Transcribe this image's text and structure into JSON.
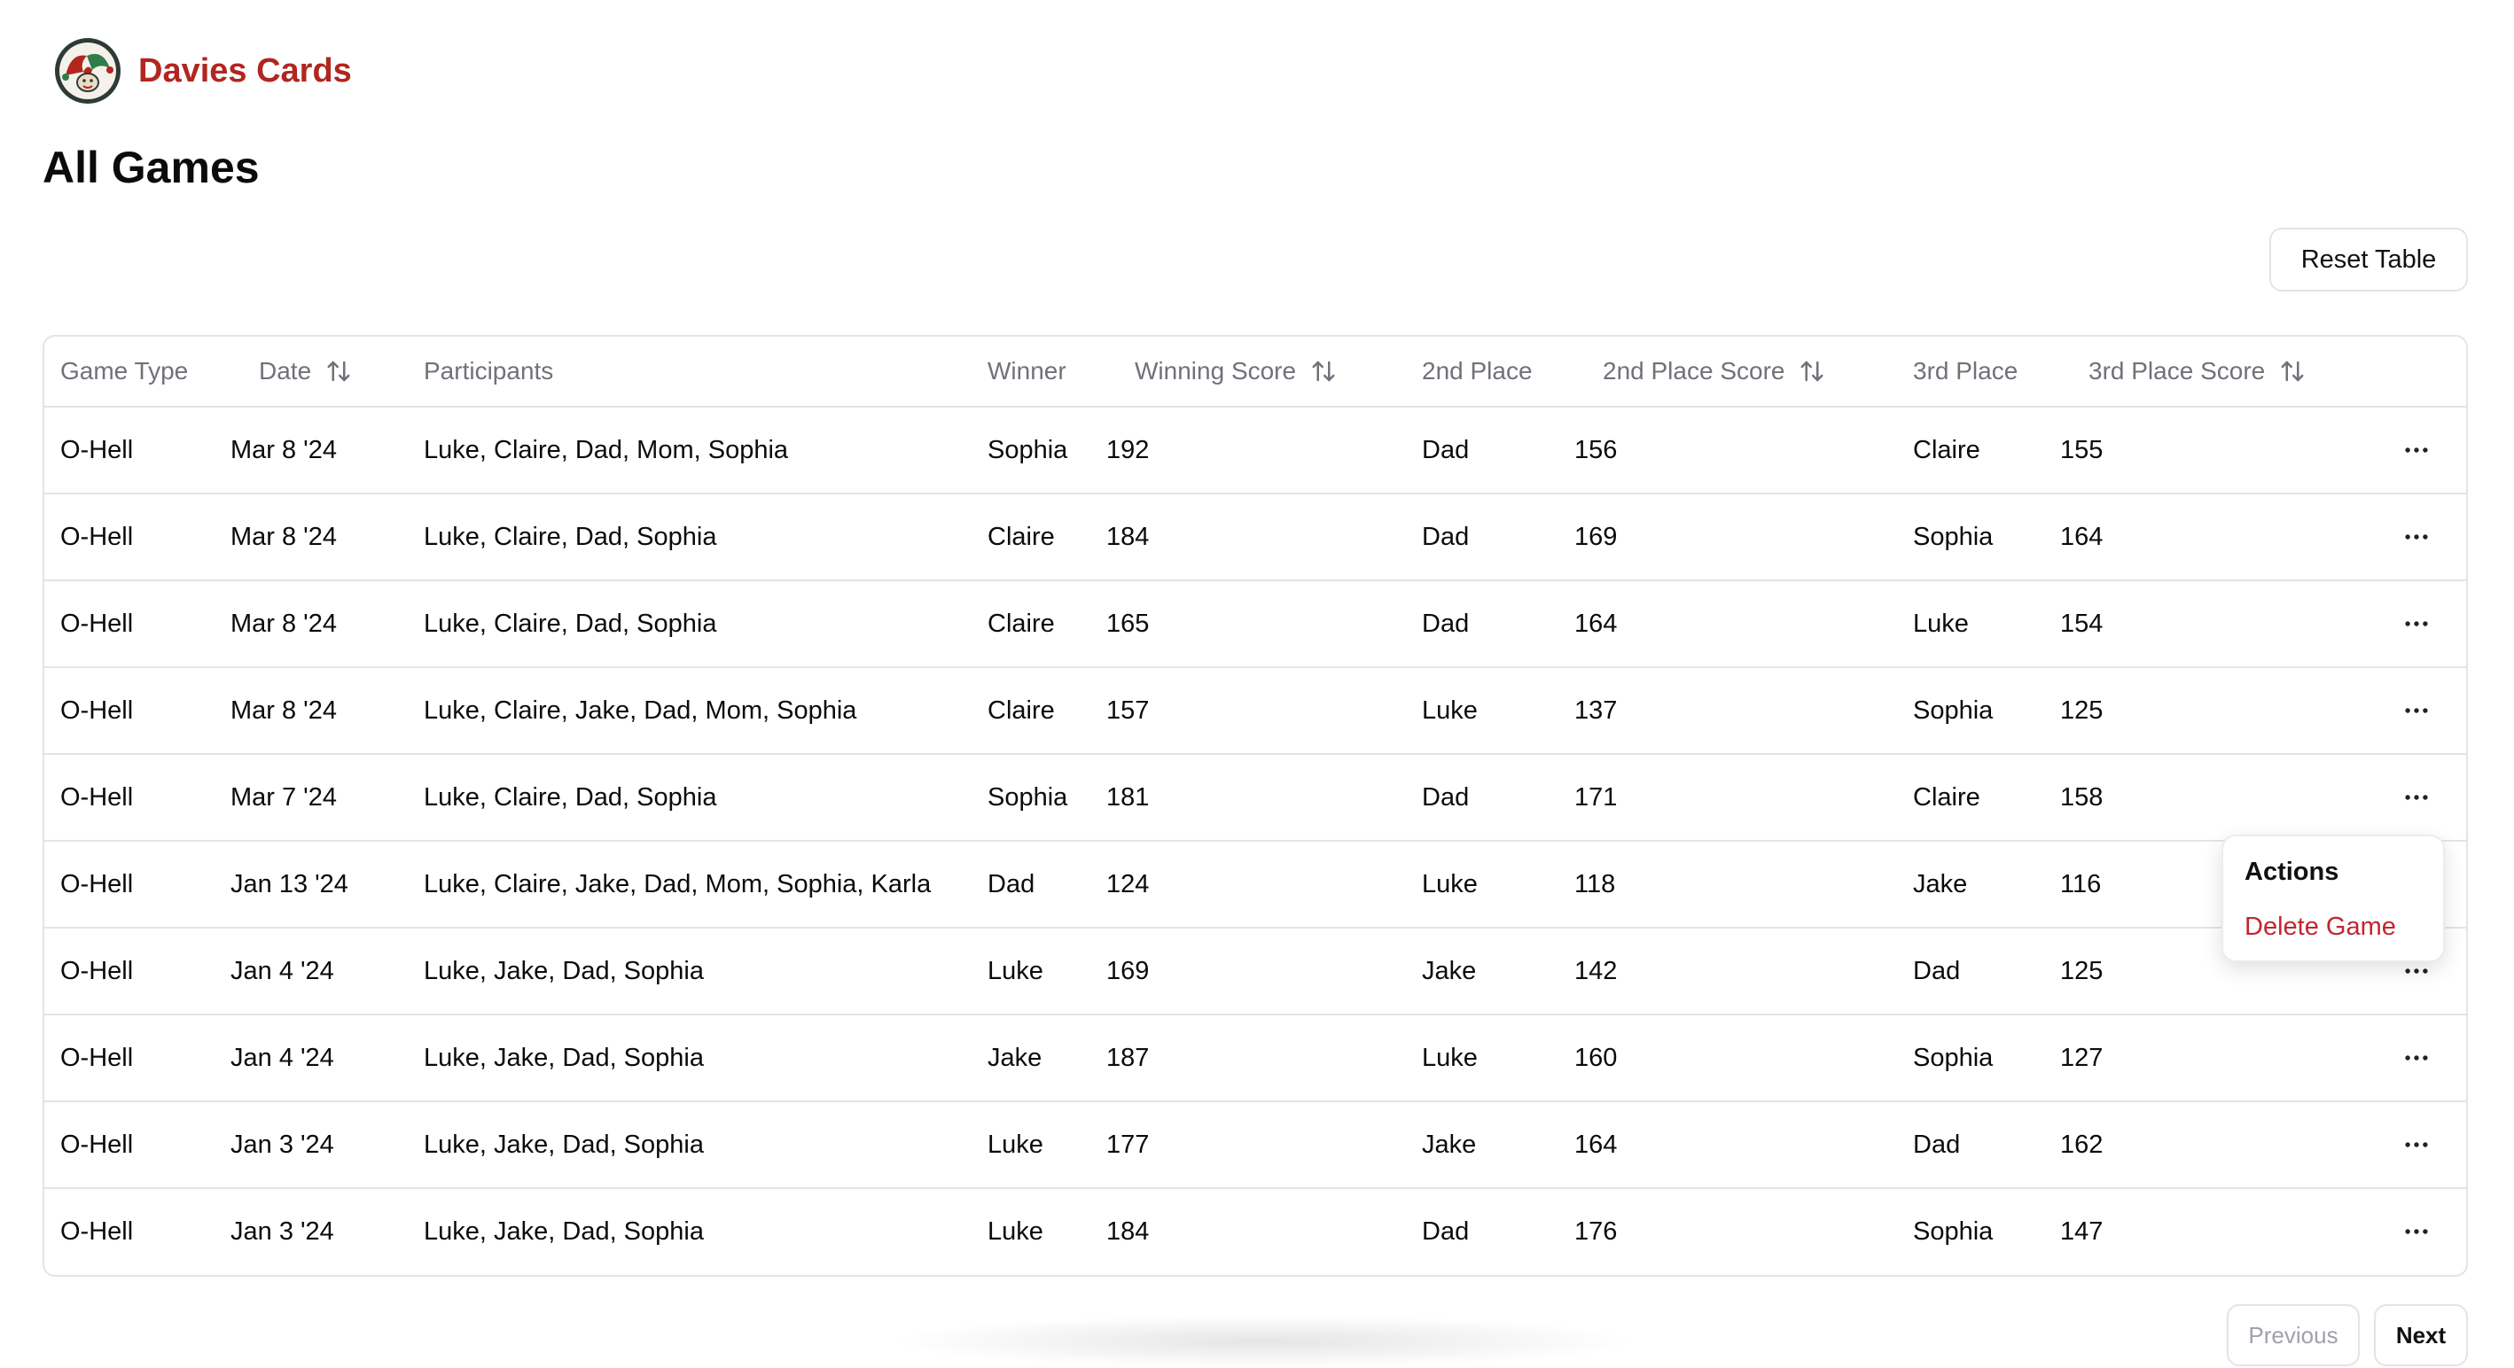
{
  "app": {
    "brand_name": "Davies Cards",
    "logo_icon": "jester-hat-logo-icon",
    "brand_color": "#b1261f"
  },
  "page": {
    "title": "All Games"
  },
  "toolbar": {
    "reset_label": "Reset Table"
  },
  "table": {
    "columns": [
      {
        "key": "game_type",
        "label": "Game Type",
        "sortable": false
      },
      {
        "key": "date",
        "label": "Date",
        "sortable": true
      },
      {
        "key": "participants",
        "label": "Participants",
        "sortable": false
      },
      {
        "key": "winner",
        "label": "Winner",
        "sortable": false
      },
      {
        "key": "winning_score",
        "label": "Winning Score",
        "sortable": true
      },
      {
        "key": "second_place",
        "label": "2nd Place",
        "sortable": false
      },
      {
        "key": "second_place_score",
        "label": "2nd Place Score",
        "sortable": true
      },
      {
        "key": "third_place",
        "label": "3rd Place",
        "sortable": false
      },
      {
        "key": "third_place_score",
        "label": "3rd Place Score",
        "sortable": true
      }
    ],
    "rows": [
      {
        "game_type": "O-Hell",
        "date": "Mar 8 '24",
        "participants": "Luke, Claire, Dad, Mom, Sophia",
        "winner": "Sophia",
        "winning_score": "192",
        "second_place": "Dad",
        "second_place_score": "156",
        "third_place": "Claire",
        "third_place_score": "155"
      },
      {
        "game_type": "O-Hell",
        "date": "Mar 8 '24",
        "participants": "Luke, Claire, Dad, Sophia",
        "winner": "Claire",
        "winning_score": "184",
        "second_place": "Dad",
        "second_place_score": "169",
        "third_place": "Sophia",
        "third_place_score": "164"
      },
      {
        "game_type": "O-Hell",
        "date": "Mar 8 '24",
        "participants": "Luke, Claire, Dad, Sophia",
        "winner": "Claire",
        "winning_score": "165",
        "second_place": "Dad",
        "second_place_score": "164",
        "third_place": "Luke",
        "third_place_score": "154"
      },
      {
        "game_type": "O-Hell",
        "date": "Mar 8 '24",
        "participants": "Luke, Claire, Jake, Dad, Mom, Sophia",
        "winner": "Claire",
        "winning_score": "157",
        "second_place": "Luke",
        "second_place_score": "137",
        "third_place": "Sophia",
        "third_place_score": "125"
      },
      {
        "game_type": "O-Hell",
        "date": "Mar 7 '24",
        "participants": "Luke, Claire, Dad, Sophia",
        "winner": "Sophia",
        "winning_score": "181",
        "second_place": "Dad",
        "second_place_score": "171",
        "third_place": "Claire",
        "third_place_score": "158"
      },
      {
        "game_type": "O-Hell",
        "date": "Jan 13 '24",
        "participants": "Luke, Claire, Jake, Dad, Mom, Sophia, Karla",
        "winner": "Dad",
        "winning_score": "124",
        "second_place": "Luke",
        "second_place_score": "118",
        "third_place": "Jake",
        "third_place_score": "116"
      },
      {
        "game_type": "O-Hell",
        "date": "Jan 4 '24",
        "participants": "Luke, Jake, Dad, Sophia",
        "winner": "Luke",
        "winning_score": "169",
        "second_place": "Jake",
        "second_place_score": "142",
        "third_place": "Dad",
        "third_place_score": "125"
      },
      {
        "game_type": "O-Hell",
        "date": "Jan 4 '24",
        "participants": "Luke, Jake, Dad, Sophia",
        "winner": "Jake",
        "winning_score": "187",
        "second_place": "Luke",
        "second_place_score": "160",
        "third_place": "Sophia",
        "third_place_score": "127"
      },
      {
        "game_type": "O-Hell",
        "date": "Jan 3 '24",
        "participants": "Luke, Jake, Dad, Sophia",
        "winner": "Luke",
        "winning_score": "177",
        "second_place": "Jake",
        "second_place_score": "164",
        "third_place": "Dad",
        "third_place_score": "162"
      },
      {
        "game_type": "O-Hell",
        "date": "Jan 3 '24",
        "participants": "Luke, Jake, Dad, Sophia",
        "winner": "Luke",
        "winning_score": "184",
        "second_place": "Dad",
        "second_place_score": "176",
        "third_place": "Sophia",
        "third_place_score": "147"
      }
    ],
    "row_actions_icon": "more-horizontal-icon",
    "sort_icon": "sort-arrows-icon"
  },
  "actions_menu": {
    "label": "Actions",
    "delete_label": "Delete Game",
    "delete_color": "#c0262d"
  },
  "pagination": {
    "previous_label": "Previous",
    "next_label": "Next"
  }
}
